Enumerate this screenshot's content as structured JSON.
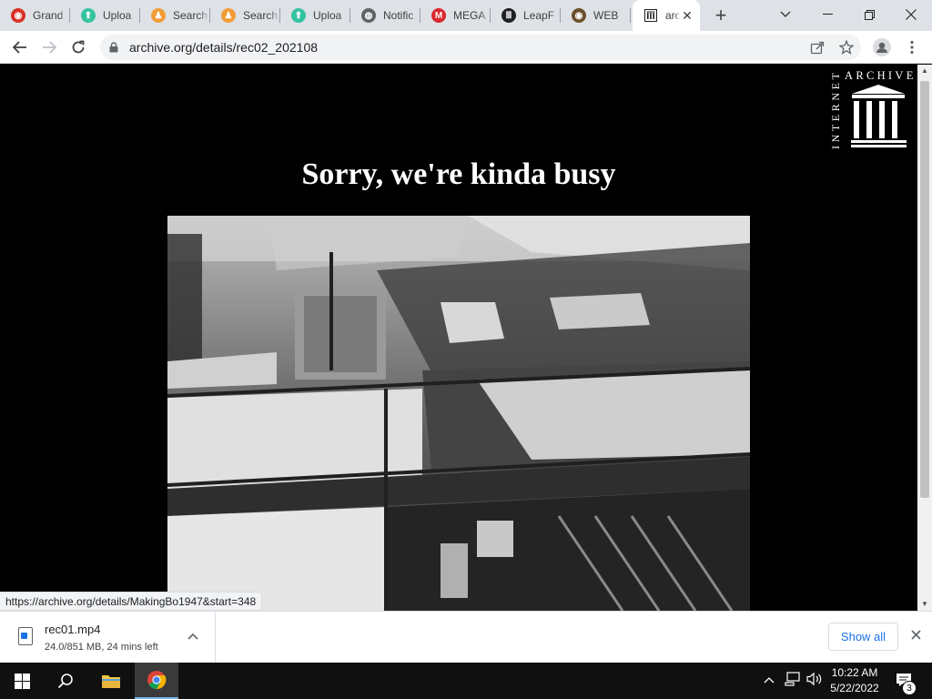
{
  "browser": {
    "tabs": [
      {
        "title": "Grand",
        "icon": "red-circle-icon",
        "color": "#d93025"
      },
      {
        "title": "Uploa",
        "icon": "upload-cloud-icon",
        "color": "#34c3a0"
      },
      {
        "title": "Search",
        "icon": "person-icon",
        "color": "#f29c38"
      },
      {
        "title": "Search",
        "icon": "person-icon",
        "color": "#f29c38"
      },
      {
        "title": "Uploa",
        "icon": "upload-cloud-icon",
        "color": "#34c3a0"
      },
      {
        "title": "Notific",
        "icon": "globe-icon",
        "color": "#5f6368"
      },
      {
        "title": "MEGA",
        "icon": "mega-icon",
        "color": "#d9272e"
      },
      {
        "title": "LeapF",
        "icon": "archive-building-icon",
        "color": "#202124"
      },
      {
        "title": "WEB",
        "icon": "eye-icon",
        "color": "#6b4f2a"
      }
    ],
    "active_tab": {
      "title": "arc",
      "icon": "archive-building-icon"
    },
    "url": "archive.org/details/rec02_202108"
  },
  "page": {
    "logo_text_top": "ARCHIVE",
    "logo_text_side": "INTERNET",
    "heading": "Sorry, we're kinda busy",
    "status_url": "https://archive.org/details/MakingBo1947&start=348"
  },
  "downloads": {
    "file_name": "rec01.mp4",
    "status": "24.0/851 MB, 24 mins left",
    "show_all": "Show all"
  },
  "taskbar": {
    "time": "10:22 AM",
    "date": "5/22/2022",
    "notification_count": "3"
  }
}
